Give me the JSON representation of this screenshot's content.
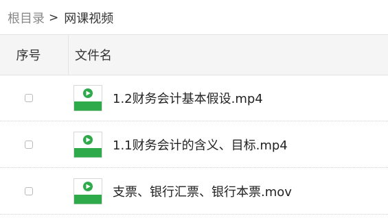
{
  "breadcrumb": {
    "root": "根目录",
    "separator": ">",
    "current": "网课视频"
  },
  "table": {
    "headers": {
      "index": "序号",
      "name": "文件名"
    },
    "rows": [
      {
        "name": "1.2财务会计基本假设.mp4",
        "icon": "video-file-icon",
        "checked": false
      },
      {
        "name": "1.1财务会计的含义、目标.mp4",
        "icon": "video-file-icon",
        "checked": false
      },
      {
        "name": "支票、银行汇票、银行本票.mov",
        "icon": "video-file-icon",
        "checked": false
      }
    ]
  },
  "colors": {
    "icon_green": "#2faa4a",
    "header_bg": "#f5f5f5",
    "breadcrumb_root": "#888888"
  }
}
